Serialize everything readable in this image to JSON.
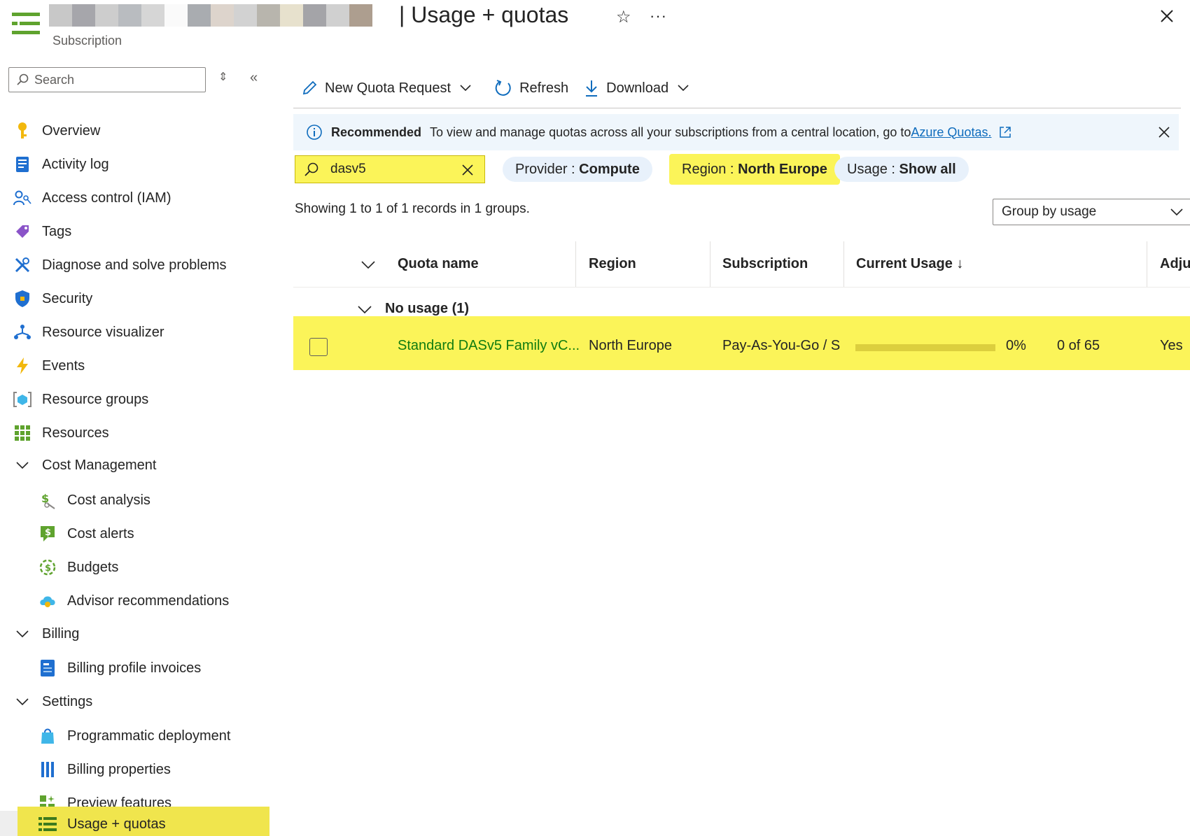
{
  "header": {
    "title": "| Usage + quotas",
    "subtitle": "Subscription",
    "star_icon": "star-icon",
    "more_label": "···",
    "close_icon": "close-icon"
  },
  "sidebar": {
    "search_placeholder": "Search",
    "items": [
      {
        "label": "Overview",
        "icon": "key-icon"
      },
      {
        "label": "Activity log",
        "icon": "activity-log-icon"
      },
      {
        "label": "Access control (IAM)",
        "icon": "iam-icon"
      },
      {
        "label": "Tags",
        "icon": "tag-icon"
      },
      {
        "label": "Diagnose and solve problems",
        "icon": "wrench-icon"
      },
      {
        "label": "Security",
        "icon": "shield-icon"
      },
      {
        "label": "Resource visualizer",
        "icon": "visualizer-icon"
      },
      {
        "label": "Events",
        "icon": "bolt-icon"
      },
      {
        "label": "Resource groups",
        "icon": "resource-groups-icon"
      },
      {
        "label": "Resources",
        "icon": "grid-icon"
      }
    ],
    "groups": [
      {
        "label": "Cost Management",
        "items": [
          {
            "label": "Cost analysis",
            "icon": "cost-analysis-icon"
          },
          {
            "label": "Cost alerts",
            "icon": "cost-alerts-icon"
          },
          {
            "label": "Budgets",
            "icon": "budgets-icon"
          },
          {
            "label": "Advisor recommendations",
            "icon": "advisor-icon"
          }
        ]
      },
      {
        "label": "Billing",
        "items": [
          {
            "label": "Billing profile invoices",
            "icon": "invoice-icon"
          }
        ]
      },
      {
        "label": "Settings",
        "items": [
          {
            "label": "Programmatic deployment",
            "icon": "deployment-icon"
          },
          {
            "label": "Billing properties",
            "icon": "billing-properties-icon"
          },
          {
            "label": "Preview features",
            "icon": "preview-icon"
          },
          {
            "label": "Usage + quotas",
            "icon": "quotas-icon",
            "active": true
          }
        ]
      }
    ]
  },
  "toolbar": {
    "new_quota_label": "New Quota Request",
    "refresh_label": "Refresh",
    "download_label": "Download"
  },
  "banner": {
    "strong": "Recommended",
    "text": "To view and manage quotas across all your subscriptions from a central location, go to",
    "link": "Azure Quotas."
  },
  "filters": {
    "search_value": "dasv5",
    "provider": {
      "label": "Provider : ",
      "value": "Compute"
    },
    "region": {
      "label": "Region : ",
      "value": "North Europe"
    },
    "usage": {
      "label": "Usage : ",
      "value": "Show all"
    }
  },
  "records_text": "Showing 1 to 1 of 1 records in 1 groups.",
  "group_by": "Group by usage",
  "table": {
    "columns": [
      "Quota name",
      "Region",
      "Subscription",
      "Current Usage ↓",
      "Adjus"
    ],
    "group": "No usage (1)",
    "rows": [
      {
        "quota_name": "Standard DASv5 Family vC...",
        "region": "North Europe",
        "subscription": "Pay-As-You-Go / S",
        "usage_pct": "0%",
        "usage_fraction": 0,
        "usage_count": "0 of 65",
        "adjustable": "Yes"
      }
    ]
  },
  "colors": {
    "highlight": "#fbf459",
    "accent": "#0f6cbd",
    "link_green": "#107c10",
    "banner_bg": "#eff6fc"
  }
}
